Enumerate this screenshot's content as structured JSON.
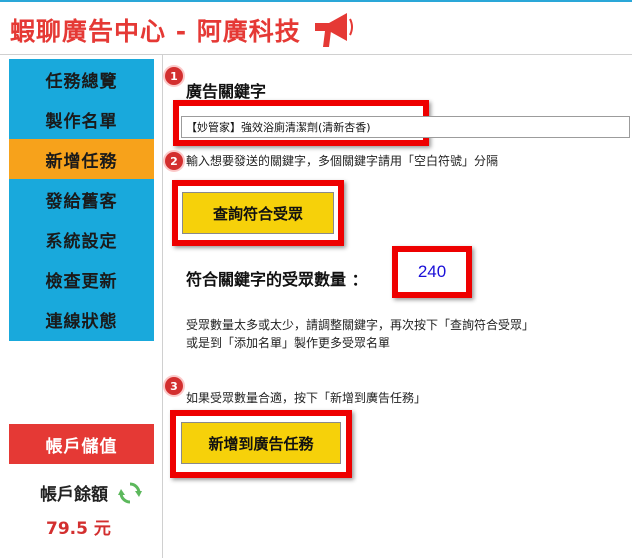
{
  "app": {
    "title": "蝦聊廣告中心 - 阿廣科技",
    "logo_icon": "megaphone-icon"
  },
  "sidebar": {
    "items": [
      {
        "label": "任務總覽",
        "active": false
      },
      {
        "label": "製作名單",
        "active": false
      },
      {
        "label": "新增任務",
        "active": true
      },
      {
        "label": "發給舊客",
        "active": false
      },
      {
        "label": "系統設定",
        "active": false
      },
      {
        "label": "檢查更新",
        "active": false
      },
      {
        "label": "連線狀態",
        "active": false
      }
    ],
    "account_button_label": "帳戶儲值",
    "balance_label": "帳戶餘額",
    "balance_value": "79.5 元",
    "refresh_icon": "refresh-icon"
  },
  "steps": {
    "one": "1",
    "two": "2",
    "three": "3"
  },
  "main": {
    "keyword_label": "廣告關鍵字",
    "keyword_value": "【妙管家】強效浴廁清潔劑(清新杏香)",
    "keyword_hint": "輸入想要發送的關鍵字，多個關鍵字請用「空白符號」分隔",
    "query_button_label": "查詢符合受眾",
    "count_label": "符合關鍵字的受眾數量 ：",
    "count_value": "240",
    "adjust_hint_line1": "受眾數量太多或太少，請調整關鍵字，再次按下「查詢符合受眾」",
    "adjust_hint_line2": "或是到「添加名單」製作更多受眾名單",
    "add_hint": "如果受眾數量合適，按下「新增到廣告任務」",
    "add_button_label": "新增到廣告任務"
  },
  "colors": {
    "brand_red": "#e53935",
    "sidebar_blue": "#19a9dc",
    "active_orange": "#f7a21b",
    "button_yellow": "#f6d10a",
    "highlight_red": "#ee0000",
    "count_blue": "#1a0fd8"
  }
}
